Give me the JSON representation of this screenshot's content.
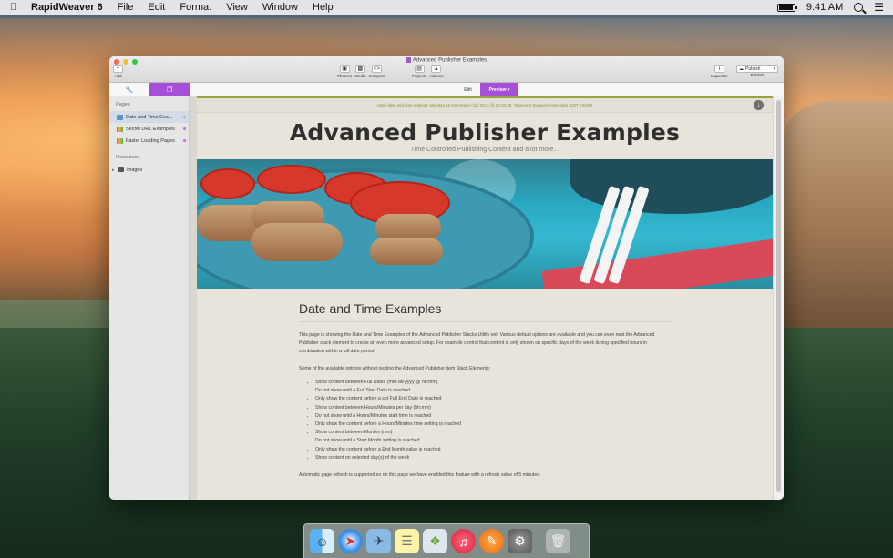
{
  "menubar": {
    "app_name": "RapidWeaver 6",
    "items": [
      "File",
      "Edit",
      "Format",
      "View",
      "Window",
      "Help"
    ],
    "time": "9:41 AM"
  },
  "window": {
    "title": "Advanced Publisher Examples",
    "toolbar": {
      "add": "Add",
      "themes": "Themes",
      "media": "Media",
      "snippets": "Snippets",
      "projects": "Projects",
      "addons": "Addons",
      "inspector": "Inspector",
      "publish_button": "Publish",
      "publish_label": "Publish"
    },
    "modes": {
      "edit": "Edit",
      "preview": "Preview"
    }
  },
  "sidebar": {
    "pages_header": "Pages",
    "pages": [
      {
        "label": "Date and Time Exa..."
      },
      {
        "label": "Secret URL Examples"
      },
      {
        "label": "Faster Loading Pages"
      }
    ],
    "resources_header": "Resources",
    "resources": [
      {
        "label": "images"
      }
    ]
  },
  "preview": {
    "notice": "Used date and time settings: Monday 15 December (12) 2014 @ 20:20:28, Timezone Europe/Amsterdam (CET +0100)",
    "site_title": "Advanced Publisher Examples",
    "site_subtitle": "Time Controlled Publishing Content and a lot more...",
    "heading": "Date and Time Examples",
    "intro": "This page is showing the Date and Time Examples of the Advanced Publisher Stacks Utility set. Various default options are available and you can even nest the Advanced Publisher stack element to create an even more advanced setup. For example control that content is only shown on specific days of the week during specified hours in combination within a full date period.",
    "options_intro": "Some of the available options without nesting the Advanced Publisher item Stack Elements:",
    "options": [
      "Show content between Full Dates (mm-dd-yyyy @ hh:mm)",
      "Do not show until a Full Start Date is reached",
      "Only show the content before a set Full End Date is reached",
      "Show content between Hours/Minutes per day (hh:mm)",
      "Do not show until a Hours/Minutes start time is reached",
      "Only show the content before a Hours/Minutes time setting is reached",
      "Show content between Months (mm)",
      "Do not show until a Start Month setting is reached",
      "Only show the content before a End Month value is reached",
      "Show content on selected day(s) of the week"
    ],
    "footer_note": "Automatic page refresh is supported so on this page we have enabled this feature with a refresh value of 5 minutes."
  },
  "colors": {
    "accent": "#a64fd8",
    "notice_text": "#8a8f30"
  }
}
